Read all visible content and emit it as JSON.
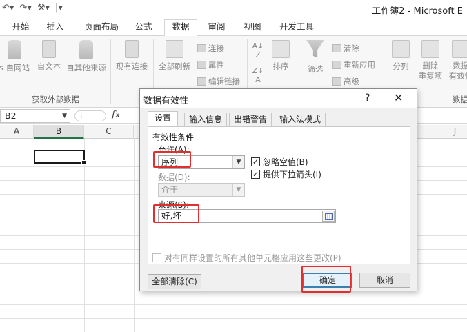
{
  "window": {
    "title": "工作簿2 - Microsoft E",
    "qat": [
      "undo-icon",
      "redo-icon",
      "customize-icon"
    ]
  },
  "ribbon": {
    "tabs": [
      "开始",
      "插入",
      "页面布局",
      "公式",
      "数据",
      "审阅",
      "视图",
      "开发工具"
    ],
    "active_tab": "数据",
    "external_data": {
      "items": [
        "s 自网站",
        "自文本",
        "自其他来源",
        "现有连接"
      ],
      "group_label": "获取外部数据"
    },
    "connections": {
      "refresh_all": "全部刷新",
      "connections": "连接",
      "properties": "属性",
      "edit_links": "编辑链接"
    },
    "sort_filter": {
      "sort": "排序",
      "filter": "筛选",
      "clear": "清除",
      "reapply": "重新应用",
      "advanced": "高级"
    },
    "data_tools": {
      "text_to_columns": "分列",
      "remove_duplicates_line1": "删除",
      "remove_duplicates_line2": "重复项",
      "validation_line1": "数据",
      "validation_line2": "有效性",
      "group_label": "数据"
    }
  },
  "formula_bar": {
    "name_box": "B2",
    "fx_label": "fx",
    "formula": ""
  },
  "sheet": {
    "columns": [
      "A",
      "B",
      "C",
      "J"
    ],
    "selected_column": "B",
    "active_cell": "B2"
  },
  "dialog": {
    "title": "数据有效性",
    "help": "?",
    "close": "✕",
    "tabs": [
      "设置",
      "输入信息",
      "出错警告",
      "输入法模式"
    ],
    "active_tab": "设置",
    "section_title": "有效性条件",
    "allow_label": "允许(A):",
    "allow_value": "序列",
    "data_label": "数据(D):",
    "data_value": "介于",
    "ignore_blank_label": "忽略空值(B)",
    "ignore_blank_checked": true,
    "dropdown_label": "提供下拉箭头(I)",
    "dropdown_checked": true,
    "source_label": "来源(S):",
    "source_value": "好,坏",
    "apply_all_label": "对有同样设置的所有其他单元格应用这些更改(P)",
    "apply_all_checked": false,
    "clear_all_button": "全部清除(C)",
    "ok_button": "确定",
    "cancel_button": "取消"
  },
  "colors": {
    "highlight": "#e12e2e",
    "excel_green": "#217346",
    "ok_border": "#3c7fb1"
  }
}
